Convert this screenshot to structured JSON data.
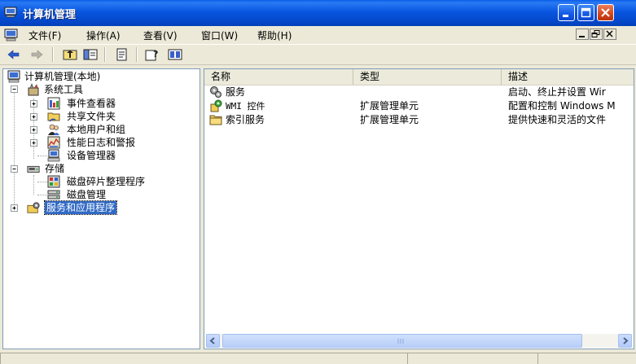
{
  "window": {
    "title": "计算机管理"
  },
  "menu": {
    "items": [
      "文件(F)",
      "操作(A)",
      "查看(V)",
      "窗口(W)",
      "帮助(H)"
    ]
  },
  "tree": {
    "root": "计算机管理(本地)",
    "system_tools": "系统工具",
    "event_viewer": "事件查看器",
    "shared_folders": "共享文件夹",
    "local_users": "本地用户和组",
    "perf_logs": "性能日志和警报",
    "device_manager": "设备管理器",
    "storage": "存储",
    "defrag": "磁盘碎片整理程序",
    "disk_mgmt": "磁盘管理",
    "services_apps": "服务和应用程序"
  },
  "listview": {
    "columns": [
      "名称",
      "类型",
      "描述"
    ],
    "rows": [
      {
        "name": "服务",
        "type": "",
        "desc": "启动、终止并设置 Wir"
      },
      {
        "name": "WMI 控件",
        "type": "扩展管理单元",
        "desc": "配置和控制 Windows M"
      },
      {
        "name": "索引服务",
        "type": "扩展管理单元",
        "desc": "提供快速和灵活的文件"
      }
    ]
  },
  "colors": {
    "titlebar": "#0856e0",
    "selection": "#316ac5",
    "window_bg": "#ece9d8"
  },
  "icons": {
    "title": "computer-management-icon",
    "back": "back-arrow-icon",
    "forward": "forward-arrow-icon",
    "up": "up-folder-icon",
    "show_tree": "show-hide-tree-icon",
    "export": "export-list-icon",
    "help": "help-icon",
    "properties": "properties-icon"
  }
}
